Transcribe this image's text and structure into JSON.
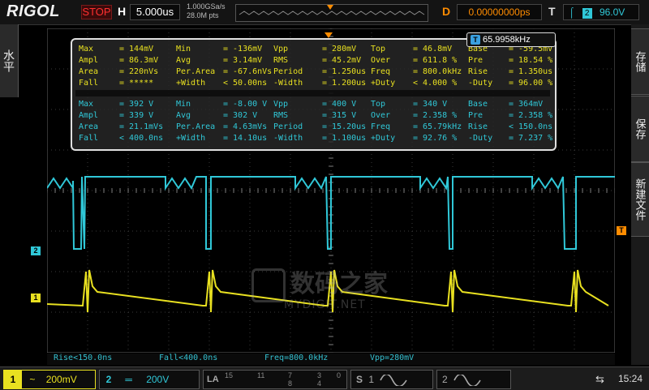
{
  "header": {
    "logo": "RIGOL",
    "run_state": "STOP",
    "h_label": "H",
    "timebase": "5.000us",
    "sample_rate": "1.000GSa/s",
    "mem_depth": "28.0M pts",
    "d_label": "D",
    "delay": "0.00000000ps",
    "t_label": "T",
    "trig_channel": "2",
    "trig_level": "96.0V"
  },
  "side": {
    "left_tab": "水平",
    "right_buttons": [
      "存储",
      "保存",
      "新建文件"
    ]
  },
  "freq_readout": {
    "icon": "T",
    "value": "65.9958kHz"
  },
  "measurements": {
    "ch1": [
      [
        "Max",
        "= 144mV",
        "Min",
        "= -136mV",
        "Vpp",
        "= 280mV",
        "Top",
        "= 46.8mV",
        "Base",
        "= -59.5mV"
      ],
      [
        "Ampl",
        "= 86.3mV",
        "Avg",
        "= 3.14mV",
        "RMS",
        "= 45.2mV",
        "Over",
        "= 611.8 %",
        "Pre",
        "= 18.54 %"
      ],
      [
        "Area",
        "= 220nVs",
        "Per.Area",
        "= -67.6nVs",
        "Period",
        "= 1.250us",
        "Freq",
        "= 800.0kHz",
        "Rise",
        "= 1.350us"
      ],
      [
        "Fall",
        "= *****",
        "+Width",
        "< 50.00ns",
        "-Width",
        "= 1.200us",
        "+Duty",
        "< 4.000 %",
        "-Duty",
        "= 96.00 %"
      ]
    ],
    "ch2": [
      [
        "Max",
        "= 392 V",
        "Min",
        "= -8.00 V",
        "Vpp",
        "= 400 V",
        "Top",
        "= 340 V",
        "Base",
        "= 364mV"
      ],
      [
        "Ampl",
        "= 339 V",
        "Avg",
        "= 302 V",
        "RMS",
        "= 315 V",
        "Over",
        "= 2.358 %",
        "Pre",
        "= 2.358 %"
      ],
      [
        "Area",
        "= 21.1mVs",
        "Per.Area",
        "= 4.63mVs",
        "Period",
        "= 15.20us",
        "Freq",
        "= 65.79kHz",
        "Rise",
        "< 150.0ns"
      ],
      [
        "Fall",
        "< 400.0ns",
        "+Width",
        "= 14.10us",
        "-Width",
        "= 1.100us",
        "+Duty",
        "= 92.76 %",
        "-Duty",
        "= 7.237 %"
      ]
    ]
  },
  "bottom_measures": [
    "Rise<150.0ns",
    "Fall<400.0ns",
    "Freq=800.0kHz",
    "Vpp=280mV"
  ],
  "markers": {
    "ch1": "1",
    "ch2": "2",
    "trigger": "T"
  },
  "status": {
    "ch1_num": "1",
    "ch1_coupling": "~",
    "ch1_scale": "200mV",
    "ch2_num": "2",
    "ch2_coupling": "═",
    "ch2_scale": "200V",
    "la_label": "LA",
    "la_channels": [
      "15",
      "11",
      "7",
      "3",
      "0"
    ],
    "la_channels_bottom": [
      "8",
      "4"
    ],
    "s1_label": "S",
    "s1_num": "1",
    "s2_num": "2",
    "time": "15:24"
  },
  "watermark": {
    "text": "数码之家",
    "url": "MYDIGIT.NET"
  },
  "colors": {
    "ch1": "#e8e020",
    "ch2": "#30c8d8",
    "trigger": "#ff8c00",
    "stop": "#ff3030"
  }
}
